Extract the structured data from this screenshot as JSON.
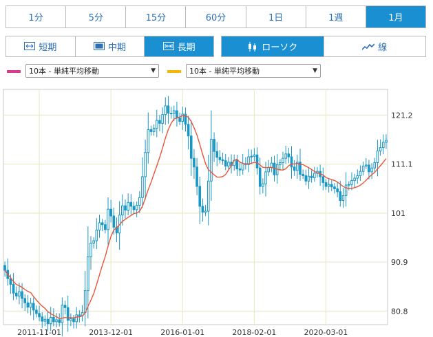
{
  "timeframes": [
    {
      "label": "1分",
      "active": false
    },
    {
      "label": "5分",
      "active": false
    },
    {
      "label": "15分",
      "active": false
    },
    {
      "label": "60分",
      "active": false
    },
    {
      "label": "1日",
      "active": false
    },
    {
      "label": "1週",
      "active": false
    },
    {
      "label": "1月",
      "active": true
    }
  ],
  "range_buttons": [
    {
      "label": "短期",
      "icon": "short-range-icon",
      "active": false
    },
    {
      "label": "中期",
      "icon": "mid-range-icon",
      "active": false
    },
    {
      "label": "長期",
      "icon": "long-range-icon",
      "active": true
    }
  ],
  "style_buttons": [
    {
      "label": "ローソク",
      "icon": "candlestick-icon",
      "active": true
    },
    {
      "label": "線",
      "icon": "line-chart-icon",
      "active": false
    }
  ],
  "moving_averages": [
    {
      "label": "10本 - 単純平均移動",
      "color": "#d63d8c"
    },
    {
      "label": "10本 - 単純平均移動",
      "color": "#f5b800"
    }
  ],
  "colors": {
    "accent": "#1a8fd2",
    "candle": "#1896c4",
    "ma_line": "#e8553a",
    "grid": "#e8e6c0"
  },
  "chart_data": {
    "type": "candlestick",
    "title": "",
    "y_ticks": [
      80.8,
      90.9,
      101,
      111.1,
      121.2
    ],
    "ylim": [
      78.0,
      126.5
    ],
    "x_ticks": [
      "2011-11-01",
      "2013-12-01",
      "2016-01-01",
      "2018-02-01",
      "2020-03-01"
    ],
    "x_tick_months": [
      12,
      37,
      62,
      87,
      112
    ],
    "overlay": "10本 - 単純平均移動",
    "close_series": [
      89.2,
      87.5,
      86.3,
      84.5,
      83.9,
      84.8,
      83.4,
      82.5,
      81.6,
      82.4,
      81.0,
      80.3,
      79.6,
      78.7,
      79.1,
      78.2,
      79.5,
      78.6,
      79.0,
      78.4,
      82.0,
      81.5,
      78.9,
      79.2,
      78.6,
      80.0,
      79.8,
      80.5,
      85.0,
      92.0,
      94.8,
      95.3,
      97.5,
      99.0,
      98.6,
      97.6,
      101.8,
      100.4,
      98.1,
      96.9,
      100.6,
      102.5,
      101.6,
      103.2,
      102.4,
      101.7,
      102.6,
      104.2,
      108.5,
      113.5,
      118.2,
      117.8,
      118.5,
      120.1,
      119.5,
      121.3,
      123.1,
      121.6,
      121.5,
      122.1,
      120.6,
      119.9,
      121.4,
      119.3,
      116.9,
      112.3,
      110.5,
      106.5,
      102.4,
      101.2,
      101.4,
      107.6,
      116.2,
      113.7,
      112.5,
      112.0,
      111.8,
      110.7,
      111.5,
      110.8,
      111.9,
      110.1,
      109.9,
      111.2,
      111.0,
      112.6,
      112.7,
      113.0,
      110.3,
      106.5,
      107.0,
      109.5,
      110.4,
      111.3,
      108.9,
      111.0,
      111.4,
      112.3,
      113.2,
      112.6,
      110.5,
      109.8,
      111.5,
      109.0,
      108.7,
      107.6,
      108.6,
      108.3,
      109.2,
      109.6,
      108.5,
      107.3,
      106.5,
      106.9,
      106.4,
      106.0,
      105.4,
      103.6,
      104.6,
      106.8,
      106.9,
      107.7,
      108.2,
      108.7,
      109.6,
      110.7,
      110.9,
      109.5,
      110.3,
      111.4,
      113.8,
      114.5,
      115.6,
      116.0
    ]
  }
}
